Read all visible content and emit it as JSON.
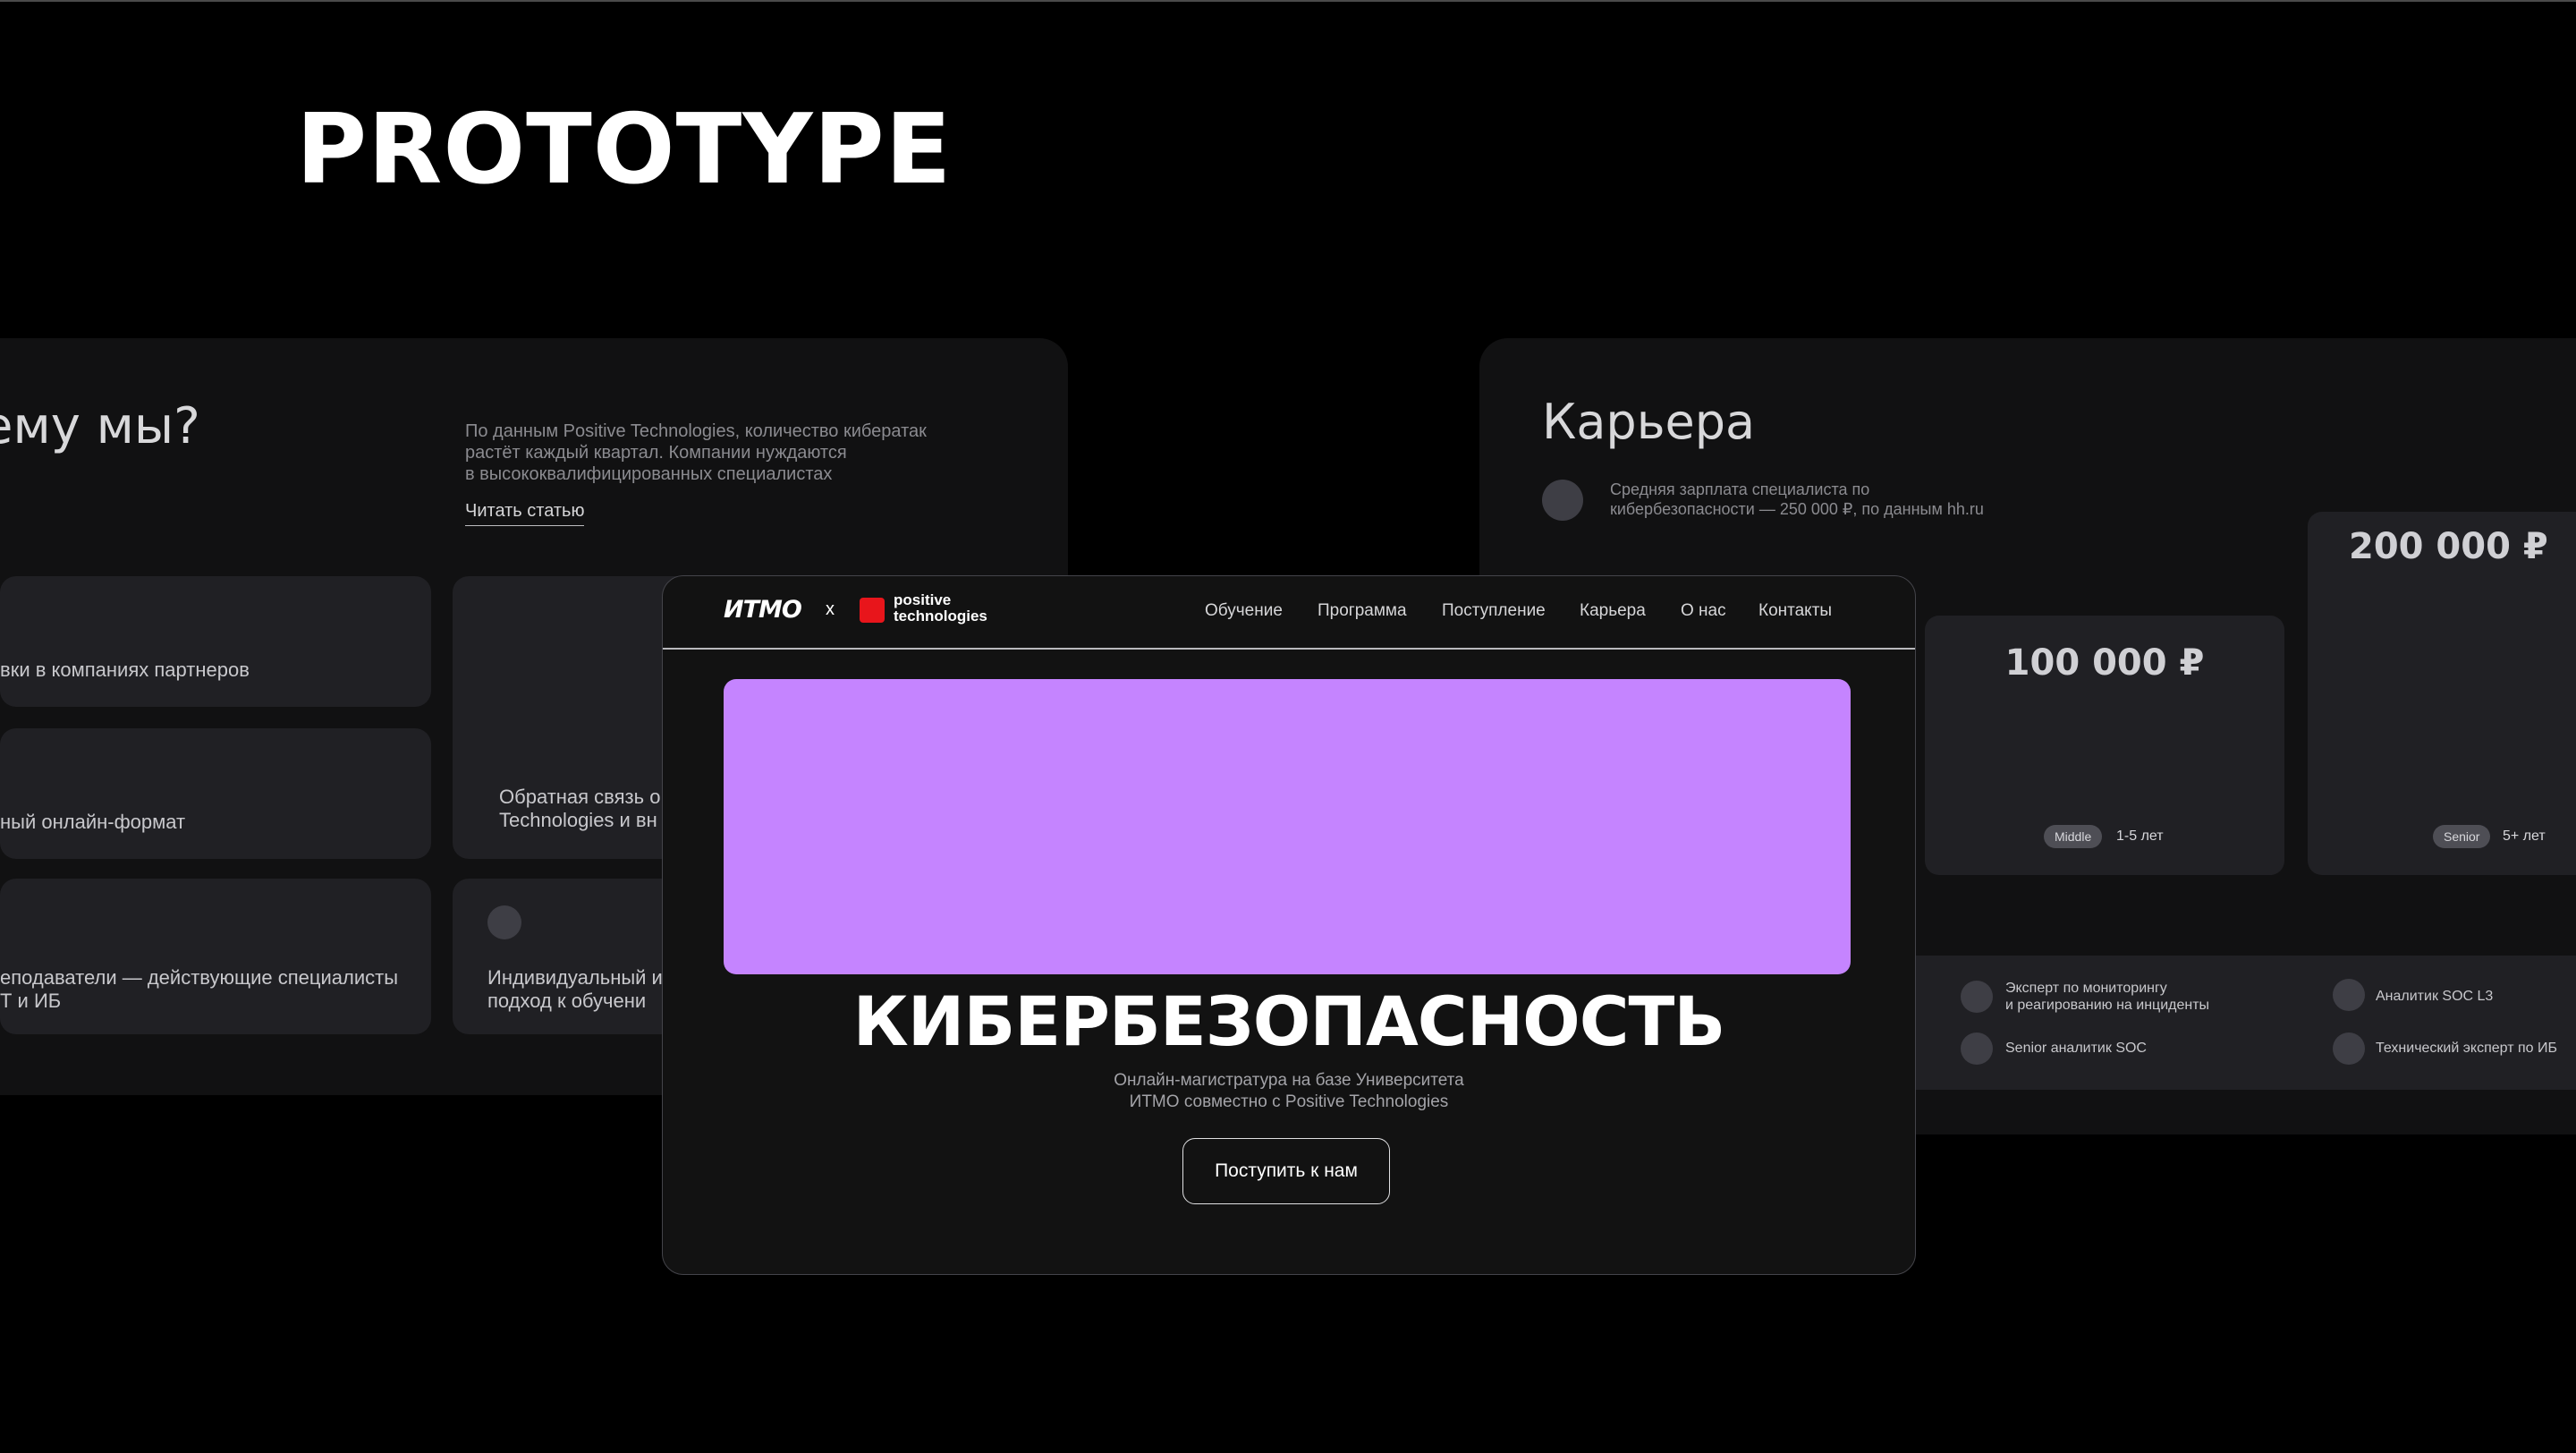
{
  "slide": {
    "title": "PROTOTYPE"
  },
  "left_panel": {
    "heading": "ему мы?",
    "description": [
      "По данным Positive Technologies, количество кибератак",
      "растёт каждый квартал. Компании нуждаются",
      "в высококвалифицированных специалистах"
    ],
    "read_link": "Читать статью",
    "cards": [
      {
        "lines": [
          "вки в компаниях партнеров"
        ]
      },
      {
        "lines": [
          "ный онлайн-формат"
        ]
      },
      {
        "lines": [
          "еподаватели — действующие специалисты",
          "Т и ИБ"
        ]
      },
      {
        "lines": [
          "Обратная связь о",
          "Technologies и вн"
        ]
      },
      {
        "lines": [
          "Индивидуальный и",
          "подход к обучени"
        ]
      }
    ]
  },
  "right_panel": {
    "heading": "Карьера",
    "note": [
      "Средняя зарплата специалиста по",
      "кибербезопасности — 250 000 ₽, по данным hh.ru"
    ],
    "salaries": [
      {
        "value": "100 000 ₽",
        "level": "Middle",
        "experience": "1-5 лет"
      },
      {
        "value": "200 000 ₽",
        "level": "Senior",
        "experience": "5+ лет"
      }
    ],
    "roles": [
      [
        "Эксперт по мониторингу",
        "и реагированию на инциденты"
      ],
      [
        "Аналитик SOC L3"
      ],
      [
        "Senior аналитик SOC"
      ],
      [
        "Технический эксперт по ИБ"
      ]
    ]
  },
  "site": {
    "logo_itmo": "ИTMO",
    "logo_x": "x",
    "logo_partner": [
      "positive",
      "technologies"
    ],
    "nav": [
      "Обучение",
      "Программа",
      "Поступление",
      "Карьера",
      "О нас",
      "Контакты"
    ],
    "hero_title": "КИБЕРБЕЗОПАСНОСТЬ",
    "hero_subtitle": [
      "Онлайн-магистратура на базе Университета",
      "ИТМО совместно с Positive Technologies"
    ],
    "cta": "Поступить к нам",
    "hero_color": "#c584ff",
    "partner_color": "#e8151b"
  }
}
